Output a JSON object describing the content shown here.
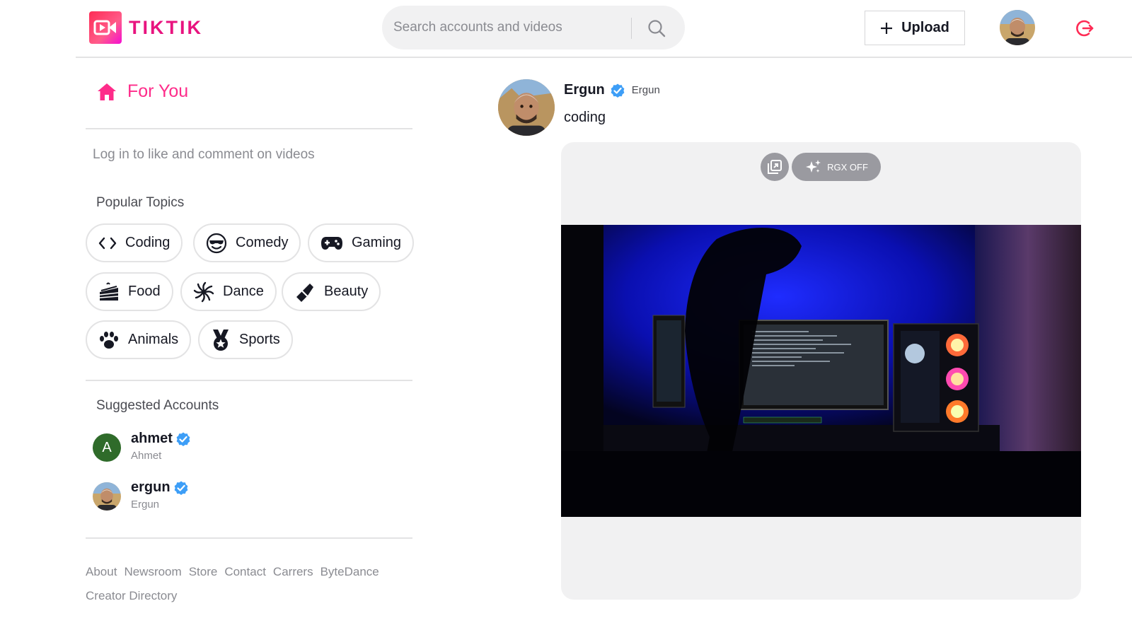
{
  "header": {
    "logo_text": "TIKTIK",
    "search_placeholder": "Search accounts and videos",
    "upload_label": "Upload",
    "logout_icon": "logout-icon",
    "brand_color": "#e8147f",
    "accent_red": "#fe2c55"
  },
  "sidebar": {
    "for_you_label": "For You",
    "login_hint": "Log in to like and comment on videos",
    "popular_topics_title": "Popular Topics",
    "topics": [
      {
        "label": "Coding",
        "icon": "code-icon"
      },
      {
        "label": "Comedy",
        "icon": "sunglasses-face-icon"
      },
      {
        "label": "Gaming",
        "icon": "gamepad-icon"
      },
      {
        "label": "Food",
        "icon": "cake-icon"
      },
      {
        "label": "Dance",
        "icon": "dance-icon"
      },
      {
        "label": "Beauty",
        "icon": "lipstick-icon"
      },
      {
        "label": "Animals",
        "icon": "paw-icon"
      },
      {
        "label": "Sports",
        "icon": "medal-icon"
      }
    ],
    "suggested_title": "Suggested Accounts",
    "accounts": [
      {
        "username": "ahmet",
        "name": "Ahmet",
        "initial": "A",
        "verified": true
      },
      {
        "username": "ergun",
        "name": "Ergun",
        "verified": true
      }
    ],
    "footer_links": [
      "About",
      "Newsroom",
      "Store",
      "Contact",
      "Carrers",
      "ByteDance",
      "Creator Directory"
    ]
  },
  "post": {
    "username": "Ergun",
    "display_name": "Ergun",
    "verified": true,
    "caption": "coding",
    "control_label": "RGX OFF"
  }
}
